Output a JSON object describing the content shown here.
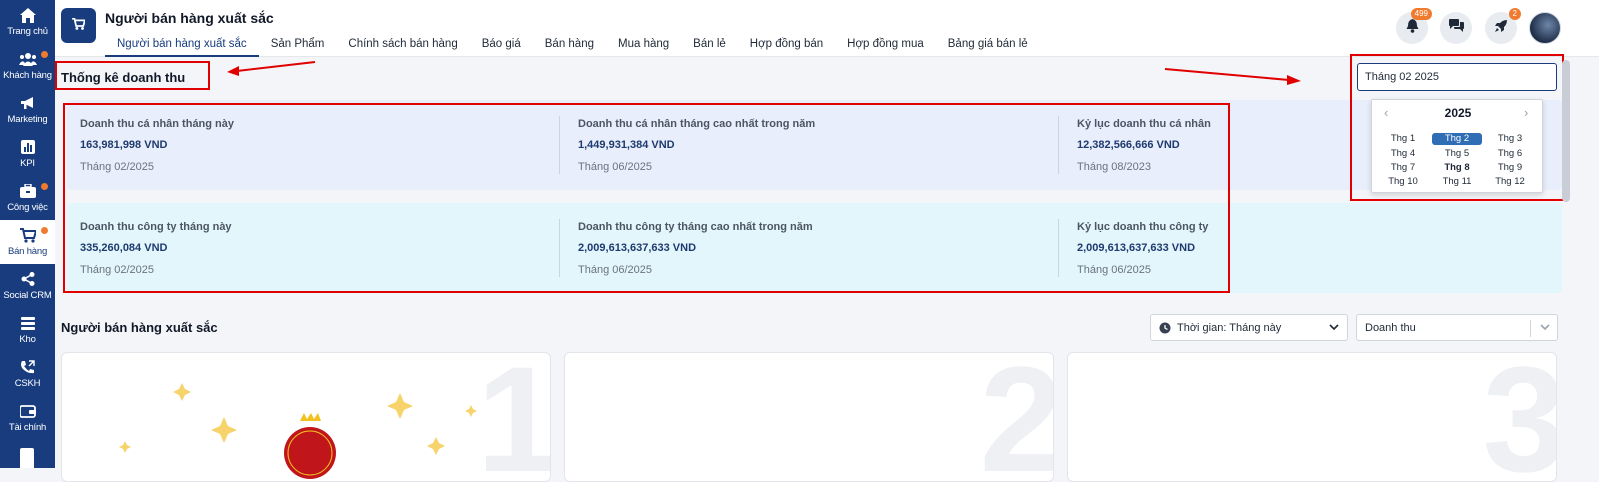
{
  "sidebar": {
    "items": [
      {
        "label": "Trang chủ",
        "icon": "home-icon",
        "dot": false
      },
      {
        "label": "Khách hàng",
        "icon": "users-icon",
        "dot": true
      },
      {
        "label": "Marketing",
        "icon": "megaphone-icon",
        "dot": false
      },
      {
        "label": "KPI",
        "icon": "bar-chart-icon",
        "dot": false
      },
      {
        "label": "Công việc",
        "icon": "briefcase-icon",
        "dot": true
      },
      {
        "label": "Bán hàng",
        "icon": "cart-icon",
        "dot": true,
        "active": true
      },
      {
        "label": "Social CRM",
        "icon": "share-icon",
        "dot": false
      },
      {
        "label": "Kho",
        "icon": "warehouse-icon",
        "dot": false
      },
      {
        "label": "CSKH",
        "icon": "phone-icon",
        "dot": false
      },
      {
        "label": "Tài chính",
        "icon": "wallet-icon",
        "dot": false
      }
    ]
  },
  "header": {
    "title": "Người bán hàng xuất sắc",
    "tabs": [
      "Người bán hàng xuất sắc",
      "Sản Phẩm",
      "Chính sách bán hàng",
      "Báo giá",
      "Bán hàng",
      "Mua hàng",
      "Bán lẻ",
      "Hợp đồng bán",
      "Hợp đồng mua",
      "Bảng giá bán lẻ"
    ],
    "active_tab": 0,
    "notification_count": "499",
    "rocket_count": "2"
  },
  "stats": {
    "title": "Thống kê doanh thu",
    "personal": [
      {
        "label": "Doanh thu cá nhân tháng này",
        "value": "163,981,998 VND",
        "sub": "Tháng 02/2025"
      },
      {
        "label": "Doanh thu cá nhân tháng cao nhất trong năm",
        "value": "1,449,931,384 VND",
        "sub": "Tháng 06/2025"
      },
      {
        "label": "Kỷ lục doanh thu cá nhân",
        "value": "12,382,566,666 VND",
        "sub": "Tháng 08/2023"
      }
    ],
    "company": [
      {
        "label": "Doanh thu công ty tháng này",
        "value": "335,260,084 VND",
        "sub": "Tháng 02/2025"
      },
      {
        "label": "Doanh thu công ty tháng cao nhất trong năm",
        "value": "2,009,613,637,633 VND",
        "sub": "Tháng 06/2025"
      },
      {
        "label": "Kỷ lục doanh thu công ty",
        "value": "2,009,613,637,633 VND",
        "sub": "Tháng 06/2025"
      }
    ]
  },
  "month_picker": {
    "value": "Tháng 02 2025",
    "year": "2025",
    "months": [
      "Thg 1",
      "Thg 2",
      "Thg 3",
      "Thg 4",
      "Thg 5",
      "Thg 6",
      "Thg 7",
      "Thg 8",
      "Thg 9",
      "Thg 10",
      "Thg 11",
      "Thg 12"
    ],
    "selected": "Thg 2",
    "current": "Thg 8"
  },
  "top_sellers": {
    "title": "Người bán hàng xuất sắc",
    "time_filter": "Thời gian: Tháng này",
    "metric_filter": "Doanh thu",
    "ranks": [
      "1",
      "2",
      "3"
    ]
  },
  "colors": {
    "sidebar": "#183c7e",
    "panel_personal": "#e8eefb",
    "panel_company": "#e3f6fb",
    "annotation": "#e00000",
    "badge": "#f07b2f"
  }
}
